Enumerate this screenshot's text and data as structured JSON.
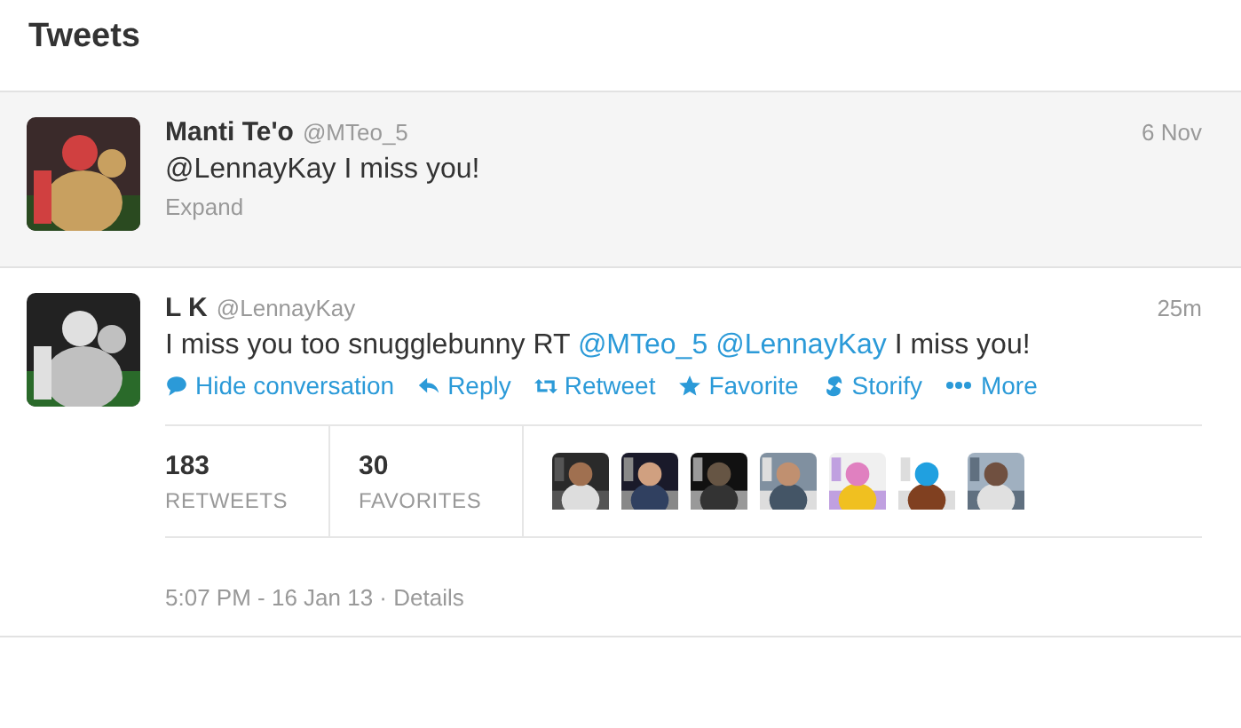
{
  "header": {
    "title": "Tweets"
  },
  "tweets": [
    {
      "name": "Manti Te'o",
      "handle": "@MTeo_5",
      "time": "6 Nov",
      "highlighted": true,
      "avatar": {
        "kind": "picture"
      },
      "parts": [
        {
          "kind": "plain",
          "text": "@LennayKay I miss you!"
        }
      ],
      "expand": "Expand"
    },
    {
      "name": "L K",
      "handle": "@LennayKay",
      "time": "25m",
      "highlighted": false,
      "avatar": {
        "kind": "picture"
      },
      "parts": [
        {
          "kind": "plain",
          "text": "I miss you too snugglebunny RT "
        },
        {
          "kind": "mention",
          "text": "@MTeo_5"
        },
        {
          "kind": "mention",
          "text": "@LennayKay"
        },
        {
          "kind": "plain",
          "text": " I miss you!"
        }
      ],
      "actions": [
        {
          "kind": "conversation",
          "label": "Hide conversation"
        },
        {
          "kind": "reply",
          "label": "Reply"
        },
        {
          "kind": "retweet",
          "label": "Retweet"
        },
        {
          "kind": "favorite",
          "label": "Favorite"
        },
        {
          "kind": "storify",
          "label": "Storify"
        },
        {
          "kind": "more",
          "label": "More"
        }
      ],
      "stats": [
        {
          "count": "183",
          "label": "RETWEETS"
        },
        {
          "count": "30",
          "label": "FAVORITES"
        }
      ],
      "favoriters": [
        {
          "kind": "picture"
        },
        {
          "kind": "picture"
        },
        {
          "kind": "picture"
        },
        {
          "kind": "picture"
        },
        {
          "kind": "picture"
        },
        {
          "kind": "picture"
        },
        {
          "kind": "picture"
        }
      ],
      "timestamp": "5:07 PM - 16 Jan 13 · Details"
    }
  ]
}
